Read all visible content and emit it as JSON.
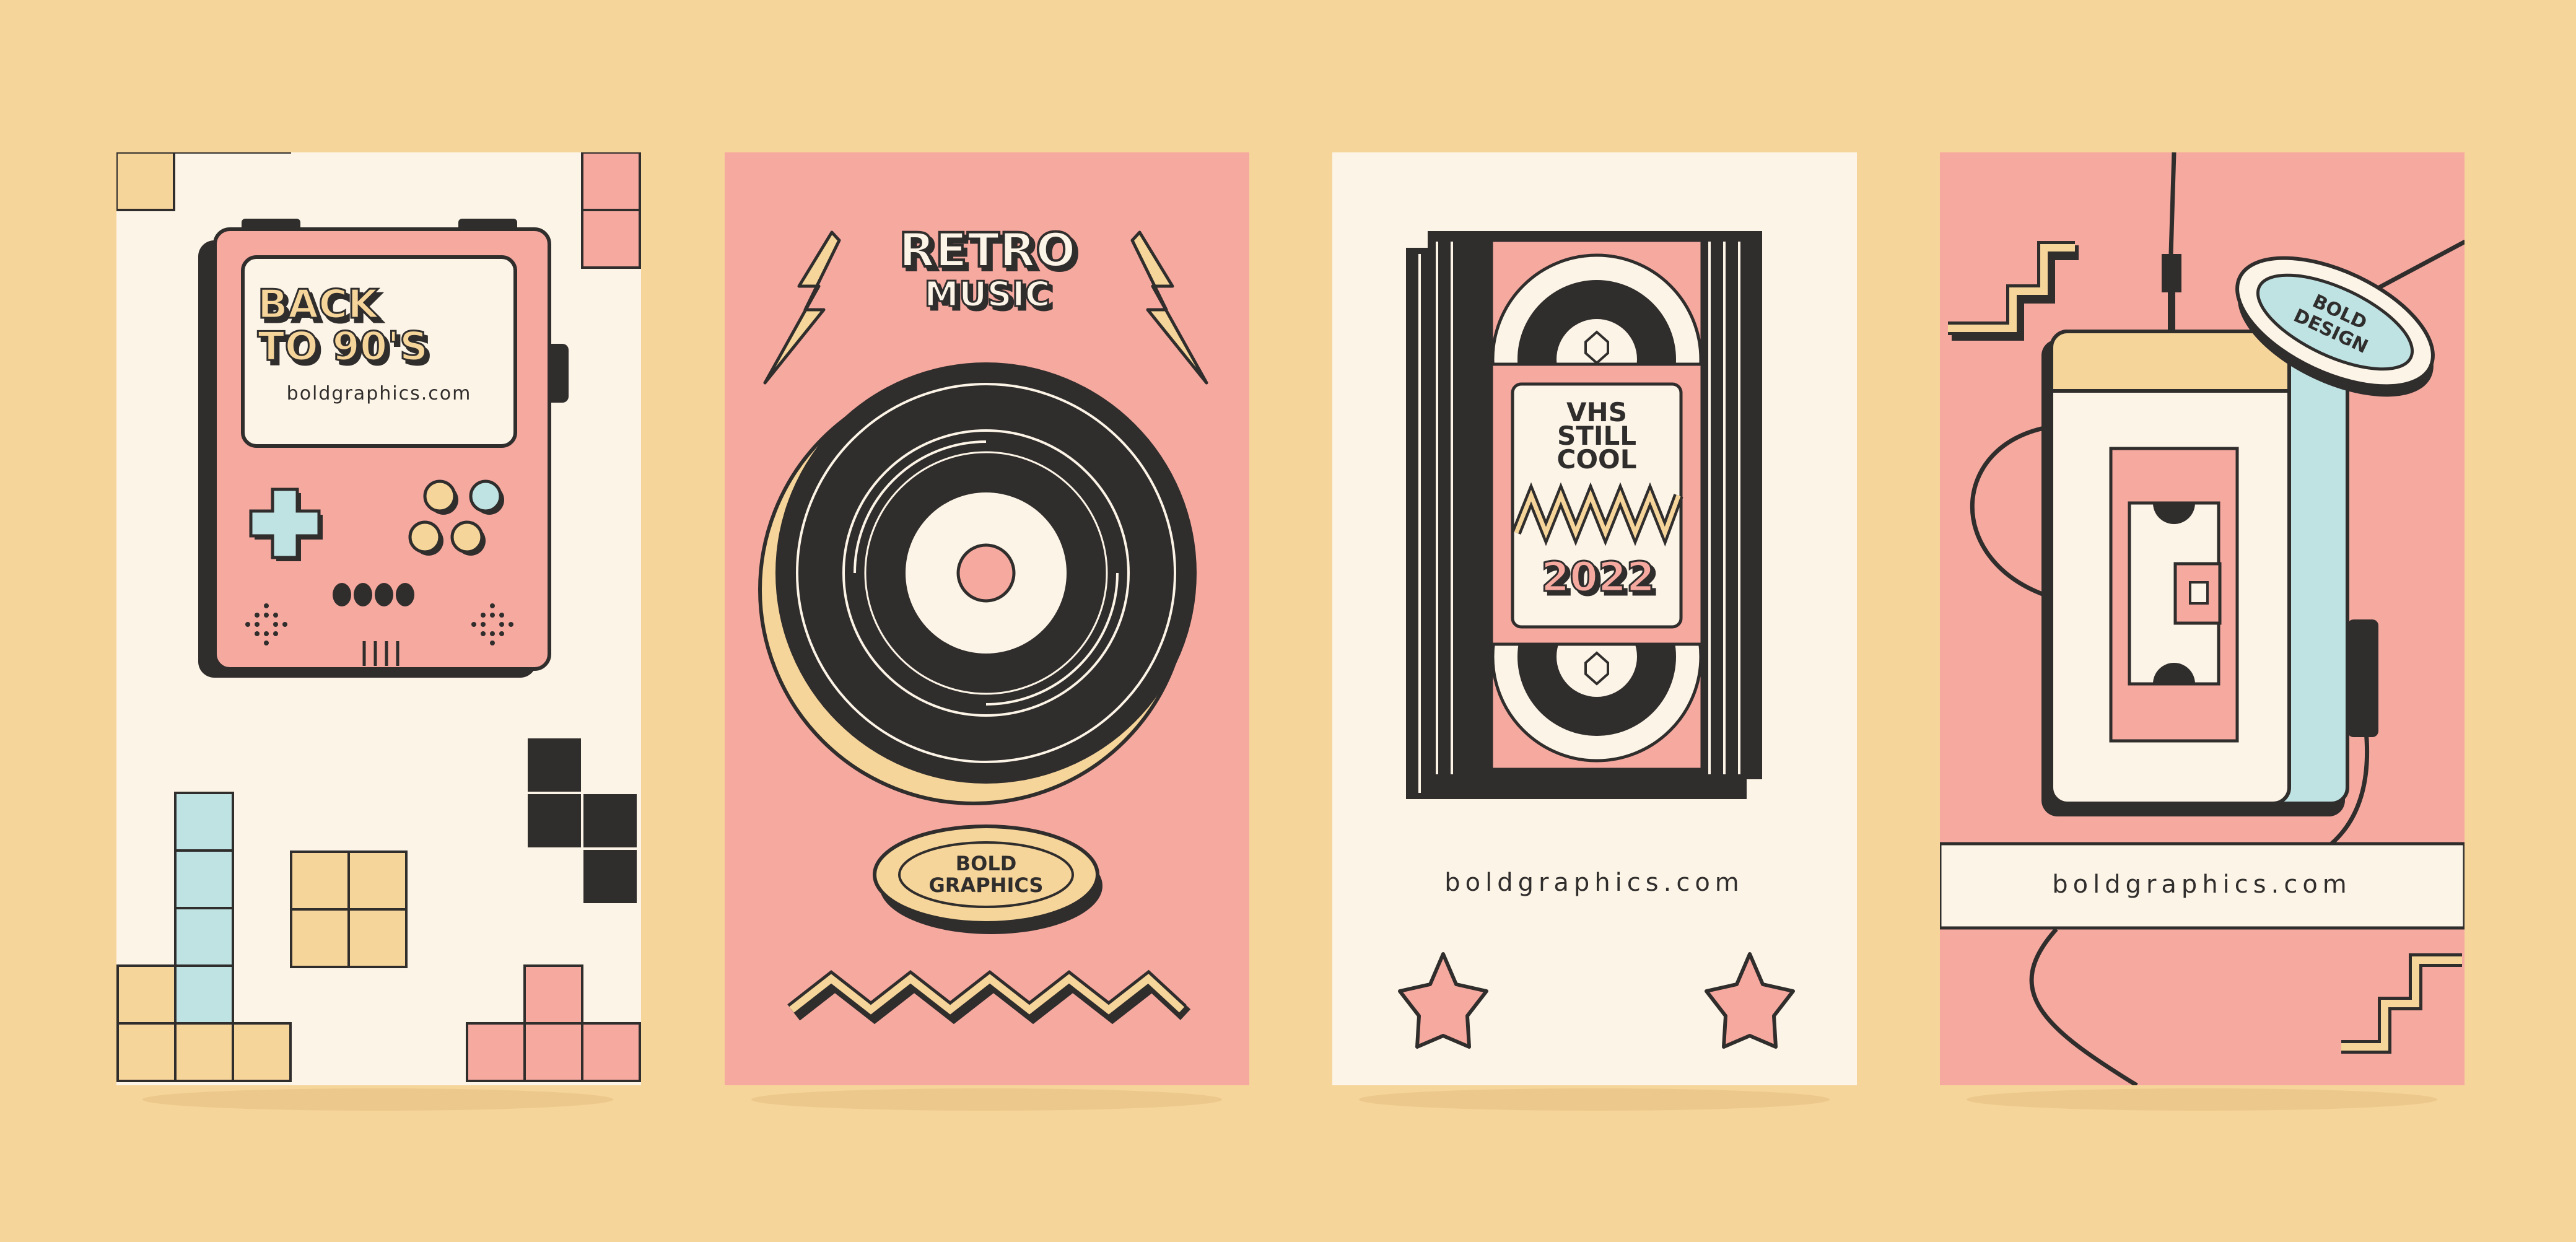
{
  "colors": {
    "background": "#f6d59a",
    "cream": "#fcf4e6",
    "pink": "#f6a99f",
    "dark": "#302d2d",
    "yellow": "#f6d59a",
    "blue": "#bfe3e3"
  },
  "cards": [
    {
      "theme": "handheld-game-console",
      "headline_line1": "BACK",
      "headline_line2": "TO 90'S",
      "website": "boldgraphics.com"
    },
    {
      "theme": "vinyl-record",
      "headline_line1": "RETRO",
      "headline_line2": "MUSIC",
      "badge_line1": "BOLD",
      "badge_line2": "GRAPHICS"
    },
    {
      "theme": "vhs-tape",
      "label_line1": "VHS",
      "label_line2": "STILL",
      "label_line3": "COOL",
      "year": "2022",
      "website": "boldgraphics.com"
    },
    {
      "theme": "cassette-player",
      "badge_line1": "BOLD",
      "badge_line2": "DESIGN",
      "website": "boldgraphics.com"
    }
  ]
}
